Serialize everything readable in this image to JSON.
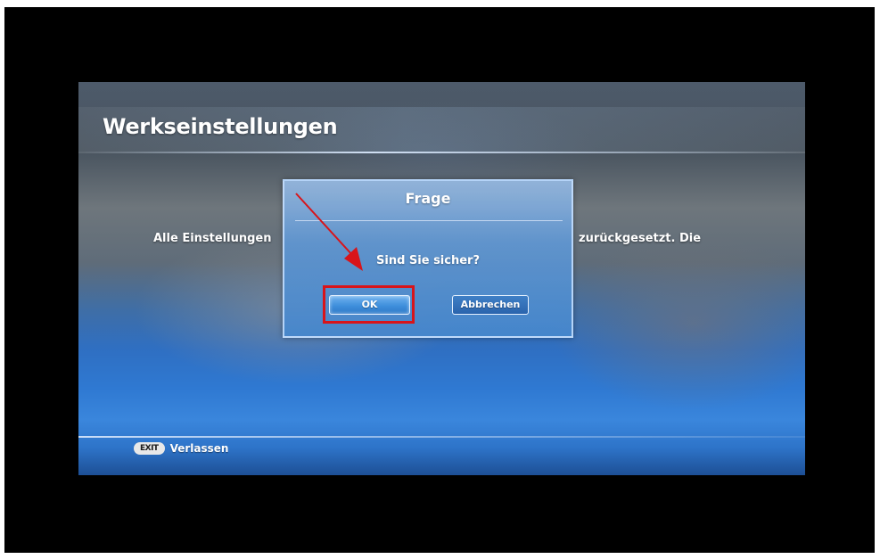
{
  "screen": {
    "title": "Werkseinstellungen",
    "body_text_left": "Alle Einstellungen",
    "body_text_right": "zurückgesetzt. Die"
  },
  "dialog": {
    "title": "Frage",
    "question": "Sind Sie sicher?",
    "ok_label": "OK",
    "cancel_label": "Abbrechen"
  },
  "footer": {
    "exit_key": "EXIT",
    "exit_label": "Verlassen"
  },
  "annotation": {
    "color": "#d8141a",
    "icon": "red-arrow-pointer"
  }
}
